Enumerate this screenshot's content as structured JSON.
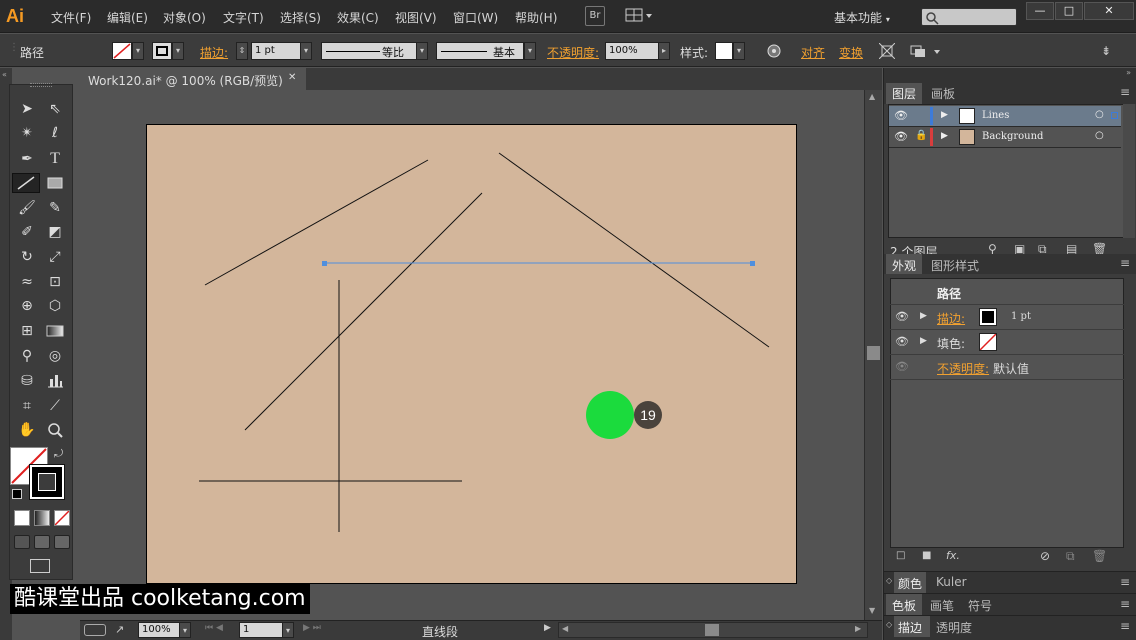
{
  "app": {
    "logo": "Ai",
    "menus": [
      "文件(F)",
      "编辑(E)",
      "对象(O)",
      "文字(T)",
      "选择(S)",
      "效果(C)",
      "视图(V)",
      "窗口(W)",
      "帮助(H)"
    ],
    "bridge_btn": "Br",
    "workspace": "基本功能",
    "window_controls": [
      "—",
      "□",
      "✕"
    ]
  },
  "control": {
    "object_type": "路径",
    "stroke_label": "描边:",
    "stroke_weight": "1 pt",
    "profile_label": "等比",
    "brush_label": "基本",
    "opacity_label": "不透明度:",
    "opacity_value": "100%",
    "style_label": "样式:",
    "align_label": "对齐",
    "transform_label": "变换"
  },
  "document": {
    "tab_title": "Work120.ai* @ 100% (RGB/预览)",
    "close": "✕"
  },
  "canvas": {
    "badge_number": "19",
    "accent": "#1bdb3d",
    "selection_color": "#4f8fde",
    "artboard_color": "#d3b69b"
  },
  "status": {
    "zoom": "100%",
    "page": "1",
    "tool_name": "直线段"
  },
  "layers_panel": {
    "tabs": [
      "图层",
      "画板"
    ],
    "layers": [
      {
        "name": "Lines",
        "color": "#3d7bd9",
        "selected": true
      },
      {
        "name": "Background",
        "color": "#d93d3d",
        "selected": false
      }
    ],
    "count": "2 个图层"
  },
  "appearance_panel": {
    "tabs": [
      "外观",
      "图形样式"
    ],
    "title": "路径",
    "stroke_label": "描边:",
    "stroke_value": "1 pt",
    "fill_label": "填色:",
    "opacity_label": "不透明度:",
    "opacity_value": "默认值"
  },
  "collapsed_panels": [
    {
      "tabs": [
        "颜色",
        "Kuler"
      ]
    },
    {
      "tabs": [
        "色板",
        "画笔",
        "符号"
      ]
    },
    {
      "tabs": [
        "描边",
        "透明度"
      ]
    }
  ],
  "watermark": "酷课堂出品 coolketang.com"
}
